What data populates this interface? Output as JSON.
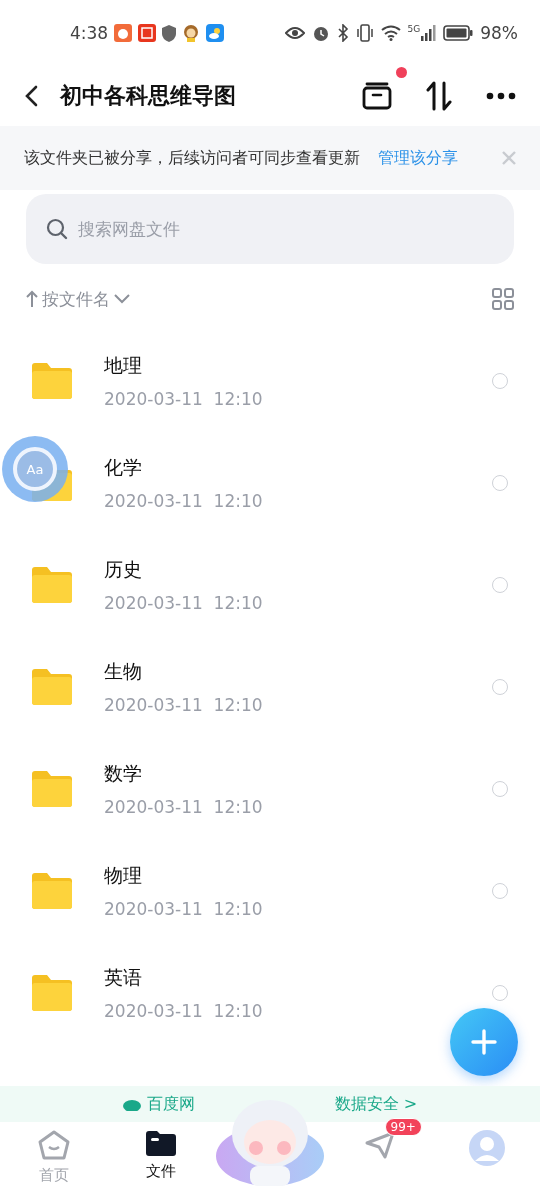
{
  "status_bar": {
    "time": "4:38",
    "battery": "98%",
    "network": "5G"
  },
  "header": {
    "title": "初中各科思维导图",
    "notification_dot": true
  },
  "share_notice": {
    "text": "该文件夹已被分享，后续访问者可同步查看更新",
    "link": "管理该分享"
  },
  "search": {
    "placeholder": "搜索网盘文件"
  },
  "sort": {
    "label": "按文件名"
  },
  "floating_tool": {
    "label": "Aa"
  },
  "files": [
    {
      "name": "地理",
      "date": "2020-03-11  12:10",
      "selected": false
    },
    {
      "name": "化学",
      "date": "2020-03-11  12:10",
      "selected": false
    },
    {
      "name": "历史",
      "date": "2020-03-11  12:10",
      "selected": false
    },
    {
      "name": "生物",
      "date": "2020-03-11  12:10",
      "selected": false
    },
    {
      "name": "数学",
      "date": "2020-03-11  12:10",
      "selected": false
    },
    {
      "name": "物理",
      "date": "2020-03-11  12:10",
      "selected": false
    },
    {
      "name": "英语",
      "date": "2020-03-11  12:10",
      "selected": false
    }
  ],
  "banner": {
    "text_left": "百度网",
    "text_right": "数据安全 >"
  },
  "nav": [
    {
      "kind": "home",
      "label": "首页",
      "selected": false
    },
    {
      "kind": "files",
      "label": "文件",
      "selected": true
    },
    {
      "kind": "mascot"
    },
    {
      "kind": "messages",
      "badge": "99+",
      "selected": false
    },
    {
      "kind": "profile",
      "selected": false
    }
  ]
}
